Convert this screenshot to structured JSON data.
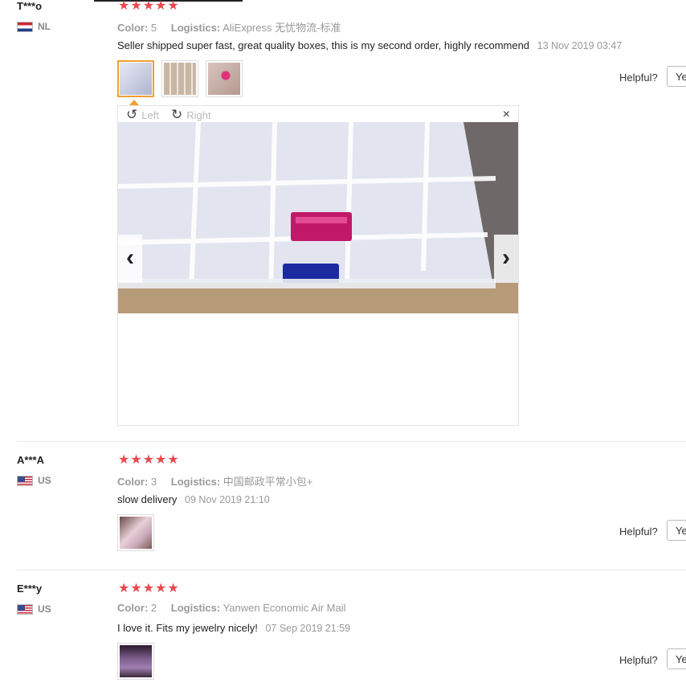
{
  "reviews": [
    {
      "user": "T***o",
      "country": "NL",
      "stars": "★★★★★",
      "color_label": "Color:",
      "color_value": "5",
      "logistics_label": "Logistics:",
      "logistics_value": "AliExpress 无忧物流-标准",
      "text": "Seller shipped super fast, great quality boxes, this is my second order, highly recommend",
      "date": "13 Nov 2019 03:47",
      "helpful_label": "Helpful?",
      "yes_label": "Ye"
    },
    {
      "user": "A***A",
      "country": "US",
      "stars": "★★★★★",
      "color_label": "Color:",
      "color_value": "3",
      "logistics_label": "Logistics:",
      "logistics_value": "中国邮政平常小包+",
      "text": "slow delivery",
      "date": "09 Nov 2019 21:10",
      "helpful_label": "Helpful?",
      "yes_label": "Ye"
    },
    {
      "user": "E***y",
      "country": "US",
      "stars": "★★★★★",
      "color_label": "Color:",
      "color_value": "2",
      "logistics_label": "Logistics:",
      "logistics_value": "Yanwen Economic Air Mail",
      "text": "I love it. Fits my jewelry nicely!",
      "date": "07 Sep 2019 21:59",
      "helpful_label": "Helpful?",
      "yes_label": "Ye"
    }
  ],
  "viewer": {
    "rotate_left_label": "Left",
    "rotate_right_label": "Right",
    "close_glyph": "×",
    "prev_glyph": "‹",
    "next_glyph": "›",
    "rotate_left_glyph": "↺",
    "rotate_right_glyph": "↻"
  },
  "colors": {
    "star": "#e8494f",
    "active_thumb": "#f0a030"
  }
}
